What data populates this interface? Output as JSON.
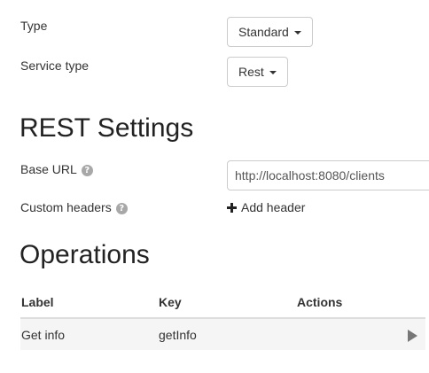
{
  "form": {
    "type_label": "Type",
    "type_value": "Standard",
    "service_type_label": "Service type",
    "service_type_value": "Rest"
  },
  "rest_settings": {
    "title": "REST Settings",
    "base_url_label": "Base URL",
    "base_url_value": "http://localhost:8080/clients",
    "custom_headers_label": "Custom headers",
    "add_header_label": "Add header",
    "help_icon_glyph": "?"
  },
  "operations": {
    "title": "Operations",
    "columns": [
      "Label",
      "Key",
      "Actions"
    ],
    "rows": [
      {
        "label": "Get info",
        "key": "getInfo"
      }
    ]
  },
  "icons": {
    "help": "question-circle-icon",
    "add": "plus-icon",
    "run": "play-icon",
    "caret": "caret-down-icon"
  }
}
